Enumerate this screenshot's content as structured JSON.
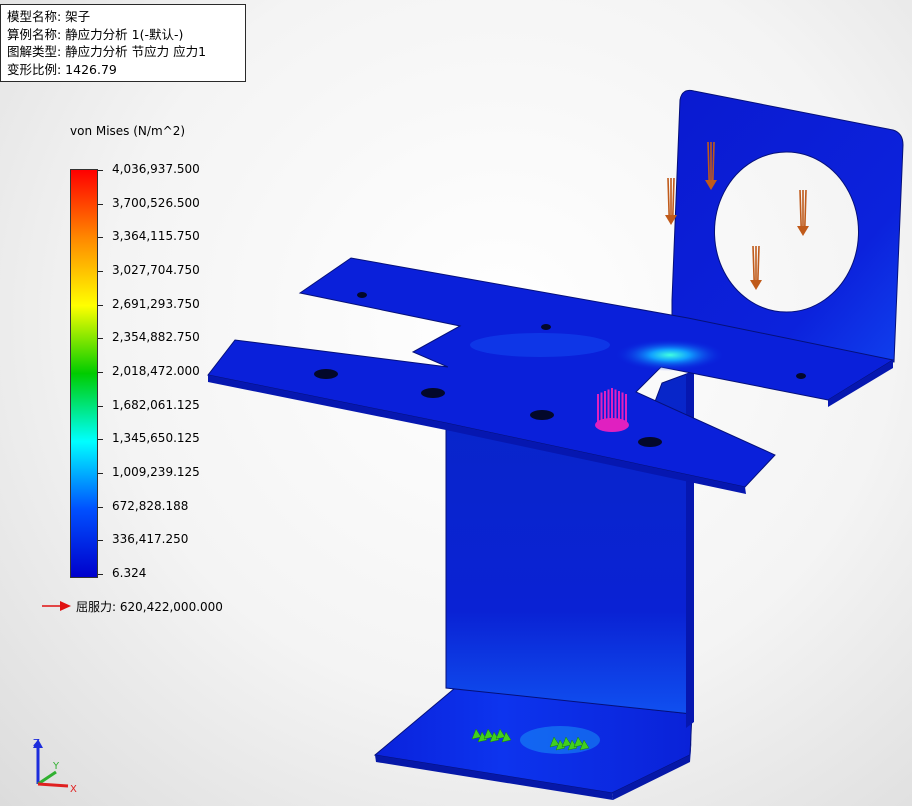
{
  "info": {
    "model_name": "模型名称: 架子",
    "study_name": "算例名称: 静应力分析 1(-默认-)",
    "plot_type": "图解类型: 静应力分析 节应力 应力1",
    "deformation_scale": "变形比例: 1426.79"
  },
  "legend": {
    "title": "von Mises (N/m^2)",
    "ticks": [
      "4,036,937.500",
      "3,700,526.500",
      "3,364,115.750",
      "3,027,704.750",
      "2,691,293.750",
      "2,354,882.750",
      "2,018,472.000",
      "1,682,061.125",
      "1,345,650.125",
      "1,009,239.125",
      "672,828.188",
      "336,417.250",
      "6.324"
    ],
    "yield_label": "屈服力: 620,422,000.000",
    "yield_arrow_color": "#e01010",
    "gradient_colors": [
      "#ff0000",
      "#ff8800",
      "#ffff00",
      "#00cc00",
      "#00ffff",
      "#0050ff",
      "#0000cc"
    ]
  },
  "model": {
    "part_color": "#0a1fd6",
    "edge_color": "#05107a",
    "load_arrow_color": "#c05a1a",
    "force_marker_color": "#e020c0",
    "fixture_color": "#40d020"
  },
  "triad": {
    "z": "Z",
    "y": "Y",
    "x": "X"
  }
}
